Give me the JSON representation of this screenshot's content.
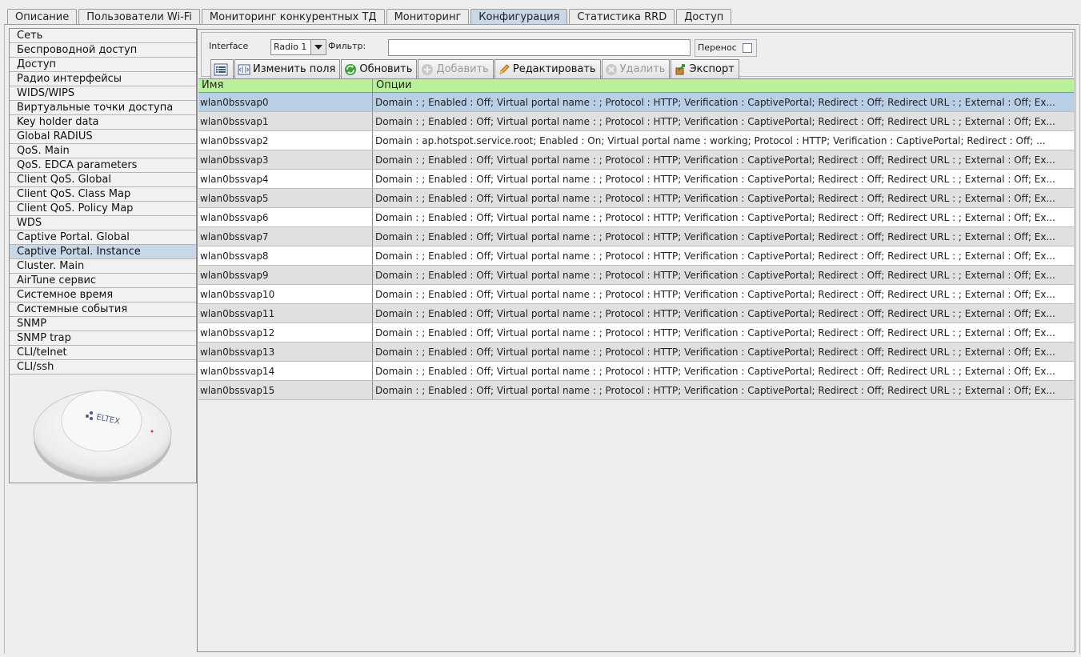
{
  "tabs": [
    {
      "label": "Описание",
      "active": false
    },
    {
      "label": "Пользователи Wi-Fi",
      "active": false
    },
    {
      "label": "Мониторинг конкурентных ТД",
      "active": false
    },
    {
      "label": "Мониторинг",
      "active": false
    },
    {
      "label": "Конфигурация",
      "active": true
    },
    {
      "label": "Статистика RRD",
      "active": false
    },
    {
      "label": "Доступ",
      "active": false
    }
  ],
  "sidebar": {
    "items": [
      {
        "label": "Сеть",
        "active": false
      },
      {
        "label": "Беспроводной доступ",
        "active": false
      },
      {
        "label": "Доступ",
        "active": false
      },
      {
        "label": "Радио интерфейсы",
        "active": false
      },
      {
        "label": "WIDS/WIPS",
        "active": false
      },
      {
        "label": "Виртуальные точки доступа",
        "active": false
      },
      {
        "label": "Key holder data",
        "active": false
      },
      {
        "label": "Global RADIUS",
        "active": false
      },
      {
        "label": "QoS. Main",
        "active": false
      },
      {
        "label": "QoS. EDCA parameters",
        "active": false
      },
      {
        "label": "Client QoS. Global",
        "active": false
      },
      {
        "label": "Client QoS. Class Map",
        "active": false
      },
      {
        "label": "Client QoS. Policy Map",
        "active": false
      },
      {
        "label": "WDS",
        "active": false
      },
      {
        "label": "Captive Portal. Global",
        "active": false
      },
      {
        "label": "Captive Portal. Instance",
        "active": true
      },
      {
        "label": "Cluster. Main",
        "active": false
      },
      {
        "label": "AirTune сервис",
        "active": false
      },
      {
        "label": "Системное время",
        "active": false
      },
      {
        "label": "Системные события",
        "active": false
      },
      {
        "label": "SNMP",
        "active": false
      },
      {
        "label": "SNMP trap",
        "active": false
      },
      {
        "label": "CLI/telnet",
        "active": false
      },
      {
        "label": "CLI/ssh",
        "active": false
      }
    ],
    "device_logo_text": "ELTEX"
  },
  "toolbar": {
    "interface_label": "Interface",
    "interface_value": "Radio 1",
    "filter_label": "Фильтр:",
    "filter_value": "",
    "wrap_label": "Перенос",
    "wrap_checked": false,
    "buttons": {
      "list_icon": "list-icon",
      "edit_fields": "Изменить поля",
      "refresh": "Обновить",
      "add": "Добавить",
      "edit": "Редактировать",
      "delete": "Удалить",
      "export": "Экспорт"
    }
  },
  "table": {
    "headers": [
      "Имя",
      "Опции"
    ],
    "selected_row": 0,
    "rows": [
      {
        "name": "wlan0bssvap0",
        "options": "Domain : ; Enabled : Off; Virtual portal name : ; Protocol : HTTP; Verification : CaptivePortal; Redirect : Off; Redirect URL : ; External : Off; Ex..."
      },
      {
        "name": "wlan0bssvap1",
        "options": "Domain : ; Enabled : Off; Virtual portal name : ; Protocol : HTTP; Verification : CaptivePortal; Redirect : Off; Redirect URL : ; External : Off; Ex..."
      },
      {
        "name": "wlan0bssvap2",
        "options": "Domain : ap.hotspot.service.root; Enabled : On; Virtual portal name : working; Protocol : HTTP; Verification : CaptivePortal; Redirect : Off; ..."
      },
      {
        "name": "wlan0bssvap3",
        "options": "Domain : ; Enabled : Off; Virtual portal name : ; Protocol : HTTP; Verification : CaptivePortal; Redirect : Off; Redirect URL : ; External : Off; Ex..."
      },
      {
        "name": "wlan0bssvap4",
        "options": "Domain : ; Enabled : Off; Virtual portal name : ; Protocol : HTTP; Verification : CaptivePortal; Redirect : Off; Redirect URL : ; External : Off; Ex..."
      },
      {
        "name": "wlan0bssvap5",
        "options": "Domain : ; Enabled : Off; Virtual portal name : ; Protocol : HTTP; Verification : CaptivePortal; Redirect : Off; Redirect URL : ; External : Off; Ex..."
      },
      {
        "name": "wlan0bssvap6",
        "options": "Domain : ; Enabled : Off; Virtual portal name : ; Protocol : HTTP; Verification : CaptivePortal; Redirect : Off; Redirect URL : ; External : Off; Ex..."
      },
      {
        "name": "wlan0bssvap7",
        "options": "Domain : ; Enabled : Off; Virtual portal name : ; Protocol : HTTP; Verification : CaptivePortal; Redirect : Off; Redirect URL : ; External : Off; Ex..."
      },
      {
        "name": "wlan0bssvap8",
        "options": "Domain : ; Enabled : Off; Virtual portal name : ; Protocol : HTTP; Verification : CaptivePortal; Redirect : Off; Redirect URL : ; External : Off; Ex..."
      },
      {
        "name": "wlan0bssvap9",
        "options": "Domain : ; Enabled : Off; Virtual portal name : ; Protocol : HTTP; Verification : CaptivePortal; Redirect : Off; Redirect URL : ; External : Off; Ex..."
      },
      {
        "name": "wlan0bssvap10",
        "options": "Domain : ; Enabled : Off; Virtual portal name : ; Protocol : HTTP; Verification : CaptivePortal; Redirect : Off; Redirect URL : ; External : Off; Ex..."
      },
      {
        "name": "wlan0bssvap11",
        "options": "Domain : ; Enabled : Off; Virtual portal name : ; Protocol : HTTP; Verification : CaptivePortal; Redirect : Off; Redirect URL : ; External : Off; Ex..."
      },
      {
        "name": "wlan0bssvap12",
        "options": "Domain : ; Enabled : Off; Virtual portal name : ; Protocol : HTTP; Verification : CaptivePortal; Redirect : Off; Redirect URL : ; External : Off; Ex..."
      },
      {
        "name": "wlan0bssvap13",
        "options": "Domain : ; Enabled : Off; Virtual portal name : ; Protocol : HTTP; Verification : CaptivePortal; Redirect : Off; Redirect URL : ; External : Off; Ex..."
      },
      {
        "name": "wlan0bssvap14",
        "options": "Domain : ; Enabled : Off; Virtual portal name : ; Protocol : HTTP; Verification : CaptivePortal; Redirect : Off; Redirect URL : ; External : Off; Ex..."
      },
      {
        "name": "wlan0bssvap15",
        "options": "Domain : ; Enabled : Off; Virtual portal name : ; Protocol : HTTP; Verification : CaptivePortal; Redirect : Off; Redirect URL : ; External : Off; Ex..."
      }
    ]
  },
  "colors": {
    "header_green": "#b7f19a",
    "selected_blue": "#b8cfe5",
    "active_tab": "#c8d8e9"
  }
}
